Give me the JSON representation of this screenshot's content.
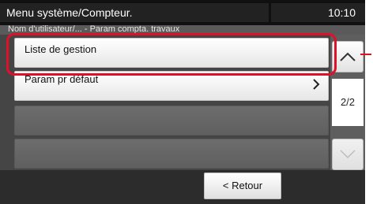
{
  "header": {
    "title": "Menu système/Compteur.",
    "time": "10:10"
  },
  "breadcrumb": "Nom d'utilisateur/... - Param compta. travaux",
  "list": {
    "items": [
      {
        "label": "Liste de gestion",
        "has_chevron": false
      },
      {
        "label": "Param pr défaut",
        "has_chevron": true
      },
      {
        "label": ""
      },
      {
        "label": ""
      }
    ]
  },
  "pagination": {
    "indicator": "2/2",
    "up_icon": "chevron-up-icon",
    "down_icon": "chevron-down-icon"
  },
  "footer": {
    "back_label": "< Retour"
  },
  "colors": {
    "highlight": "#e0102a",
    "header_bg": "#101010",
    "panel_bg": "#454545"
  }
}
